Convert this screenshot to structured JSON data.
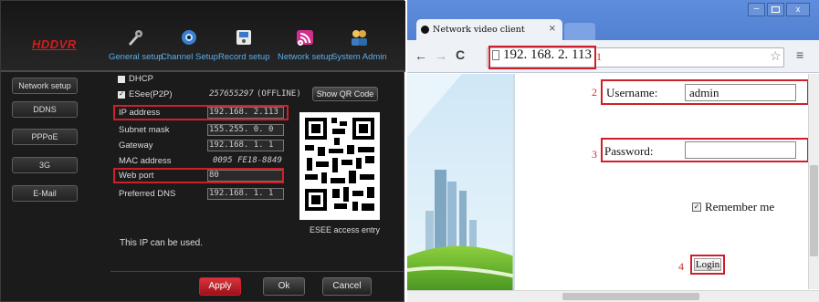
{
  "dvr": {
    "logo": "HDDVR",
    "nav": [
      {
        "label": "General setup",
        "icon": "tools-icon"
      },
      {
        "label": "Channel Setup",
        "icon": "camera-icon"
      },
      {
        "label": "Record setup",
        "icon": "disk-icon"
      },
      {
        "label": "Network setup",
        "icon": "network-icon"
      },
      {
        "label": "System Admin",
        "icon": "users-icon"
      }
    ],
    "sidebar": [
      "Network setup",
      "DDNS",
      "PPPoE",
      "3G",
      "E-Mail"
    ],
    "dhcp_label": "DHCP",
    "esee_label": "ESee(P2P)",
    "esee_id": "257655297",
    "esee_status": "(OFFLINE)",
    "show_qr": "Show QR Code",
    "fields": [
      {
        "label": "IP address",
        "value": "192.168.   2.113"
      },
      {
        "label": "Subnet mask",
        "value": "155.255.   0.  0"
      },
      {
        "label": "Gateway",
        "value": "192.168.   1.  1"
      },
      {
        "label": "MAC address",
        "value": "0095 FE18-8849"
      },
      {
        "label": "Web port",
        "value": "80"
      },
      {
        "label": "Preferred DNS",
        "value": "192.168.   1.  1"
      }
    ],
    "qr_caption": "ESEE access entry",
    "ip_note": "This IP can be used.",
    "buttons": {
      "apply": "Apply",
      "ok": "Ok",
      "cancel": "Cancel"
    },
    "colors": {
      "accent": "#cf1f2a",
      "nav": "#5aaee8"
    }
  },
  "browser": {
    "tab_title": "Network video client",
    "url": "192. 168. 2. 113",
    "steps": [
      "1",
      "2",
      "3",
      "4"
    ],
    "username_label": "Username:",
    "username_value": "admin",
    "password_label": "Password:",
    "remember_label": "Remember me",
    "login": "Login",
    "colors": {
      "chrome": "#4a77c9",
      "marker": "#d62c2c"
    }
  }
}
